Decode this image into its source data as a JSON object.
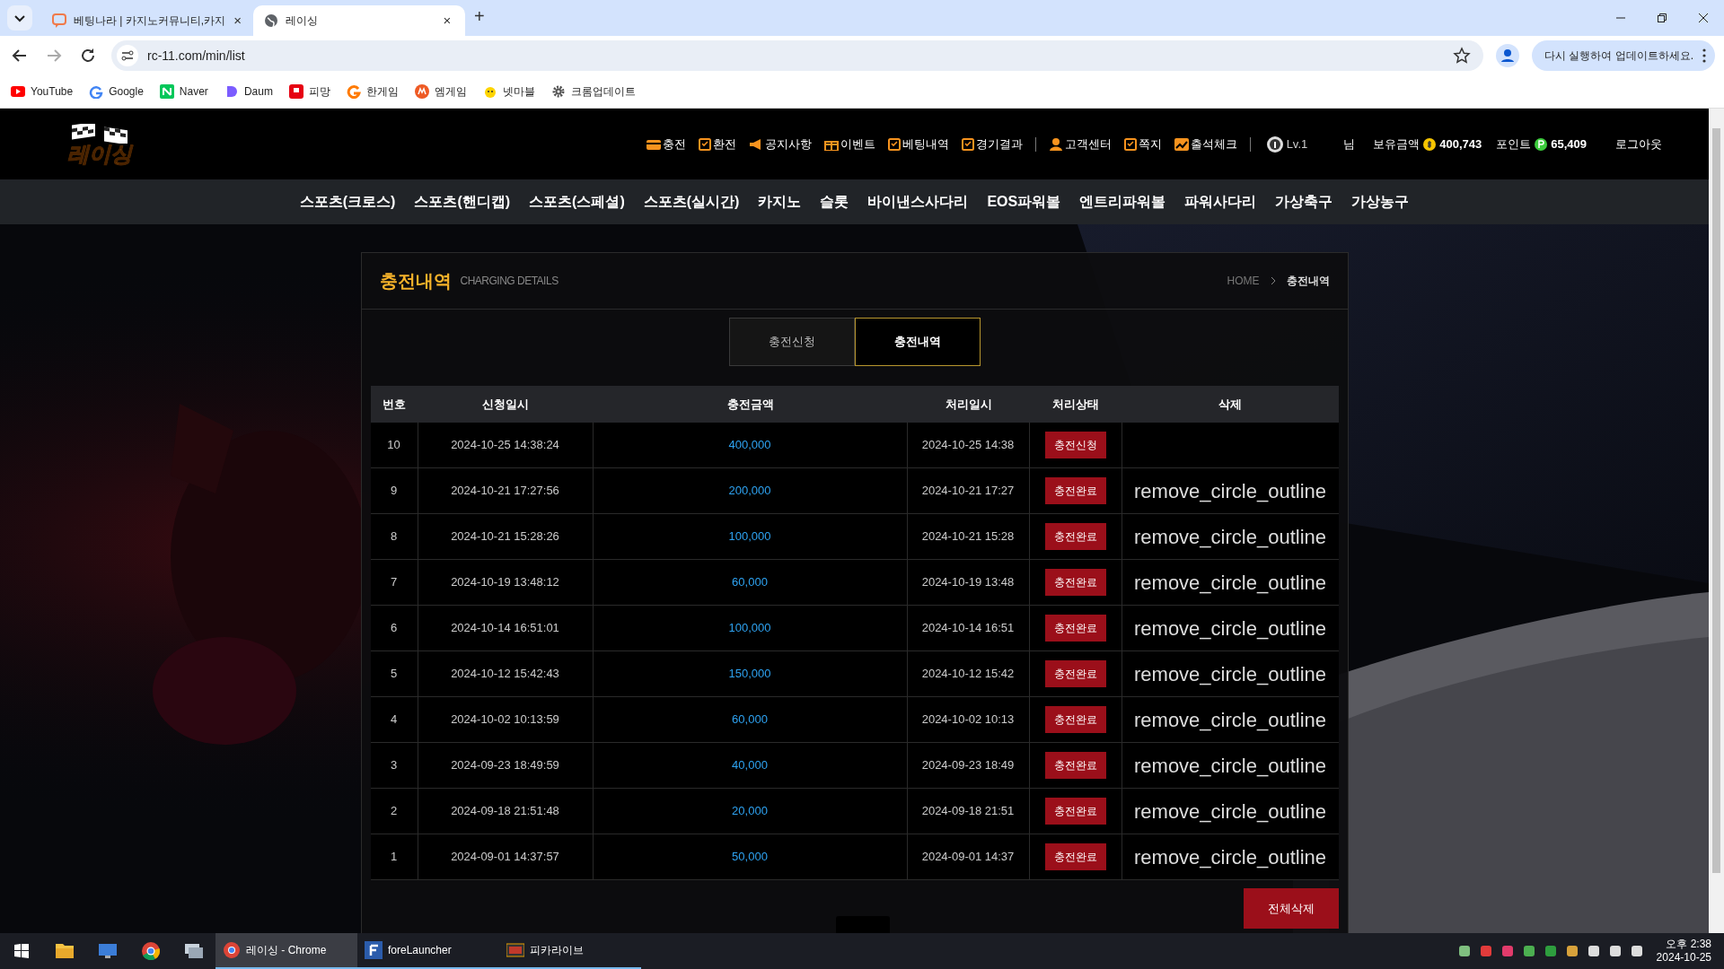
{
  "browser": {
    "tabs": [
      {
        "title": "베팅나라 | 카지노커뮤니티,카지",
        "close": "×",
        "selected": false
      },
      {
        "title": "레이싱",
        "close": "×",
        "selected": true
      }
    ],
    "new_tab": "+",
    "address": "rc-11.com/min/list",
    "update_button": "다시 실행하여 업데이트하세요.",
    "bookmarks": [
      "YouTube",
      "Google",
      "Naver",
      "Daum",
      "피망",
      "한게임",
      "엠게임",
      "넷마블",
      "크롬업데이트"
    ]
  },
  "site": {
    "logo": "레이싱",
    "menu": [
      "충전",
      "환전",
      "공지사항",
      "이벤트",
      "베팅내역",
      "경기결과",
      "고객센터",
      "쪽지",
      "출석체크"
    ],
    "level": "Lv.1",
    "user_suffix": "님",
    "balance_label": "보유금액",
    "balance": "400,743",
    "point_label": "포인트",
    "point": "65,409",
    "logout": "로그아웃",
    "nav": [
      "스포츠(크로스)",
      "스포츠(핸디캡)",
      "스포츠(스페셜)",
      "스포츠(실시간)",
      "카지노",
      "슬롯",
      "바이낸스사다리",
      "EOS파워볼",
      "엔트리파워볼",
      "파워사다리",
      "가상축구",
      "가상농구"
    ]
  },
  "panel": {
    "title": "충전내역",
    "subtitle": "CHARGING DETAILS",
    "breadcrumb": [
      "HOME",
      "충전내역"
    ],
    "tabs": [
      {
        "label": "충전신청",
        "selected": false
      },
      {
        "label": "충전내역",
        "selected": true
      }
    ],
    "table": {
      "columns": [
        "번호",
        "신청일시",
        "충전금액",
        "처리일시",
        "처리상태",
        "삭제"
      ],
      "rows": [
        {
          "no": "10",
          "requested": "2024-10-25 14:38:24",
          "amount": "400,000",
          "processed": "2024-10-25 14:38",
          "status": "충전신청"
        },
        {
          "no": "9",
          "requested": "2024-10-21 17:27:56",
          "amount": "200,000",
          "processed": "2024-10-21 17:27",
          "status": "충전완료",
          "delete": "remove_circle_outline"
        },
        {
          "no": "8",
          "requested": "2024-10-21 15:28:26",
          "amount": "100,000",
          "processed": "2024-10-21 15:28",
          "status": "충전완료",
          "delete": "remove_circle_outline"
        },
        {
          "no": "7",
          "requested": "2024-10-19 13:48:12",
          "amount": "60,000",
          "processed": "2024-10-19 13:48",
          "status": "충전완료",
          "delete": "remove_circle_outline"
        },
        {
          "no": "6",
          "requested": "2024-10-14 16:51:01",
          "amount": "100,000",
          "processed": "2024-10-14 16:51",
          "status": "충전완료",
          "delete": "remove_circle_outline"
        },
        {
          "no": "5",
          "requested": "2024-10-12 15:42:43",
          "amount": "150,000",
          "processed": "2024-10-12 15:42",
          "status": "충전완료",
          "delete": "remove_circle_outline"
        },
        {
          "no": "4",
          "requested": "2024-10-02 10:13:59",
          "amount": "60,000",
          "processed": "2024-10-02 10:13",
          "status": "충전완료",
          "delete": "remove_circle_outline"
        },
        {
          "no": "3",
          "requested": "2024-09-23 18:49:59",
          "amount": "40,000",
          "processed": "2024-09-23 18:49",
          "status": "충전완료",
          "delete": "remove_circle_outline"
        },
        {
          "no": "2",
          "requested": "2024-09-18 21:51:48",
          "amount": "20,000",
          "processed": "2024-09-18 21:51",
          "status": "충전완료",
          "delete": "remove_circle_outline"
        },
        {
          "no": "1",
          "requested": "2024-09-01 14:37:57",
          "amount": "50,000",
          "processed": "2024-09-01 14:37",
          "status": "충전완료",
          "delete": "remove_circle_outline"
        }
      ]
    },
    "delete_all": "전체삭제"
  },
  "taskbar": {
    "apps": [
      {
        "label": "레이싱 - Chrome",
        "selected": true
      },
      {
        "label": "foreLauncher",
        "selected": false
      },
      {
        "label": "피카라이브",
        "selected": false
      }
    ],
    "time": "오후 2:38",
    "date": "2024-10-25"
  }
}
